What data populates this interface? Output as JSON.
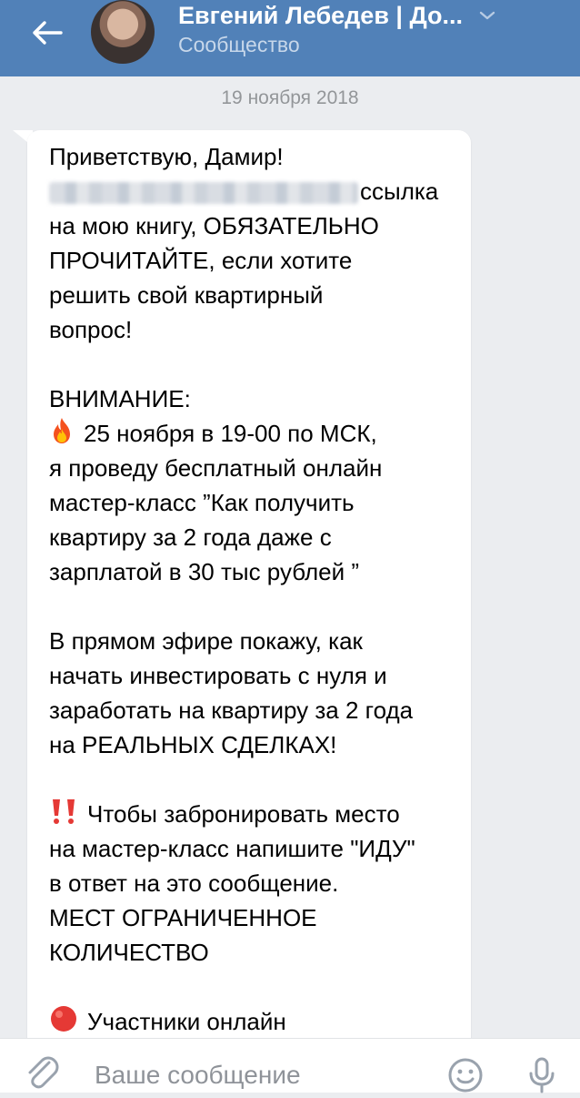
{
  "header": {
    "title": "Евгений Лебедев | До...",
    "subtitle": "Сообщество"
  },
  "chat": {
    "date": "19 ноября 2018"
  },
  "message": {
    "greeting": "Приветствую, Дамир!",
    "line_link_tail": "ссылка",
    "line_book": "на мою книгу, ОБЯЗАТЕЛЬНО",
    "line_read": "ПРОЧИТАЙТЕ, если хотите",
    "line_solve": "решить свой квартирный",
    "line_question": "вопрос!",
    "attention": "ВНИМАНИЕ:",
    "event_date": "25 ноября в 19-00 по МСК,",
    "event_line2": "я проведу бесплатный онлайн",
    "event_line3": "мастер-класс ”Как получить",
    "event_line4": "квартиру за 2 года даже с",
    "event_line5": "зарплатой в 30 тыс рублей ”",
    "live_line1": "В прямом эфире покажу, как",
    "live_line2": "начать инвестировать с нуля и",
    "live_line3": "заработать на квартиру за 2 года",
    "live_line4": "на РЕАЛЬНЫХ СДЕЛКАХ!",
    "book_line1": "Чтобы забронировать место",
    "book_line2": "на мастер-класс напишите \"ИДУ\"",
    "book_line3": "в ответ на это сообщение.",
    "limited_line1": "МЕСТ ОГРАНИЧЕННОЕ",
    "limited_line2": "КОЛИЧЕСТВО",
    "participants": "Участники онлайн"
  },
  "composer": {
    "placeholder": "Ваше сообщение"
  },
  "icons": {
    "back": "arrow-left-icon",
    "chevron": "chevron-down-icon",
    "fire": "fire-emoji-icon",
    "exclamation": "double-exclamation-emoji-icon",
    "red_circle": "red-circle-emoji-icon",
    "attach": "paperclip-icon",
    "emoji": "smiley-icon",
    "mic": "microphone-icon"
  },
  "colors": {
    "header_bg": "#5181b8",
    "chat_bg": "#ebedf0",
    "bubble_bg": "#ffffff",
    "subtitle": "#c7d7ea",
    "placeholder": "#8f9399"
  }
}
